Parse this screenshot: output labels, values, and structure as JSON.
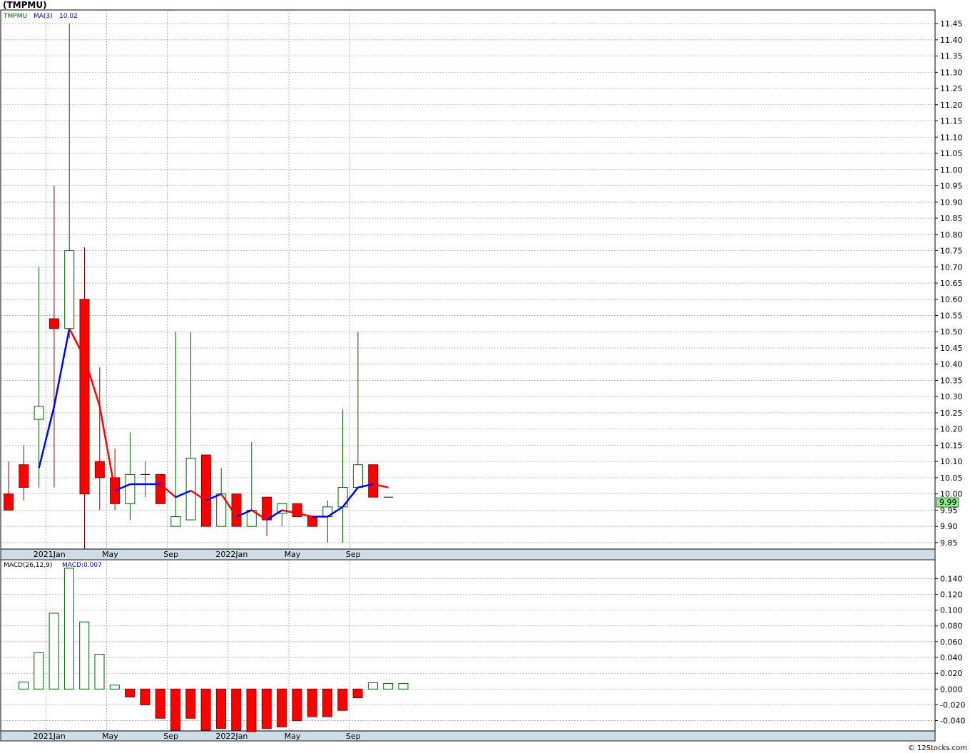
{
  "symbol_title": "(TMPMU)",
  "footer": "© 12Stocks.com",
  "colors": {
    "up": "#006400",
    "down": "#8b0000",
    "down_fill": "#ff0000",
    "ma_up": "#0000ff",
    "ma_down": "#ff0000",
    "axis_band": "#ccdde8",
    "last_price_bg": "#88ee88"
  },
  "chart_data": [
    {
      "type": "candlestick",
      "legend": {
        "symbol": "TMPMU",
        "ma_label": "MA(3)",
        "ma_value": "10.02"
      },
      "last_price_label": "9.99",
      "ylim": [
        9.83,
        11.47
      ],
      "y_ticks": [
        "9.85",
        "9.90",
        "9.95",
        "10.00",
        "10.05",
        "10.10",
        "10.15",
        "10.20",
        "10.25",
        "10.30",
        "10.35",
        "10.40",
        "10.45",
        "10.50",
        "10.55",
        "10.60",
        "10.65",
        "10.70",
        "10.75",
        "10.80",
        "10.85",
        "10.90",
        "10.95",
        "11.00",
        "11.05",
        "11.10",
        "11.15",
        "11.20",
        "11.25",
        "11.30",
        "11.35",
        "11.40",
        "11.45"
      ],
      "x_labels": [
        {
          "label": "2021Jan",
          "index": 3
        },
        {
          "label": "May",
          "index": 7
        },
        {
          "label": "Sep",
          "index": 11
        },
        {
          "label": "2022Jan",
          "index": 15
        },
        {
          "label": "May",
          "index": 19
        },
        {
          "label": "Sep",
          "index": 23
        }
      ],
      "x_gridlines_after_index": [
        3,
        7,
        11,
        15,
        19,
        23
      ],
      "candles": [
        {
          "o": 10.0,
          "h": 10.1,
          "l": 9.95,
          "c": 9.95
        },
        {
          "o": 10.09,
          "h": 10.15,
          "l": 9.98,
          "c": 10.02
        },
        {
          "o": 10.23,
          "h": 10.7,
          "l": 10.02,
          "c": 10.27
        },
        {
          "o": 10.54,
          "h": 10.95,
          "l": 10.02,
          "c": 10.51
        },
        {
          "o": 10.51,
          "h": 11.45,
          "l": 10.48,
          "c": 10.75
        },
        {
          "o": 10.6,
          "h": 10.76,
          "l": 9.83,
          "c": 10.0
        },
        {
          "o": 10.1,
          "h": 10.39,
          "l": 9.95,
          "c": 10.05
        },
        {
          "o": 10.05,
          "h": 10.14,
          "l": 9.95,
          "c": 9.97
        },
        {
          "o": 9.97,
          "h": 10.19,
          "l": 9.92,
          "c": 10.06
        },
        {
          "o": 10.06,
          "h": 10.1,
          "l": 9.99,
          "c": 10.06
        },
        {
          "o": 10.06,
          "h": 10.06,
          "l": 9.97,
          "c": 9.97
        },
        {
          "o": 9.9,
          "h": 10.5,
          "l": 9.9,
          "c": 9.93
        },
        {
          "o": 9.92,
          "h": 10.5,
          "l": 9.92,
          "c": 10.11
        },
        {
          "o": 10.12,
          "h": 10.12,
          "l": 9.9,
          "c": 9.9
        },
        {
          "o": 9.9,
          "h": 10.08,
          "l": 9.9,
          "c": 10.0
        },
        {
          "o": 10.0,
          "h": 10.0,
          "l": 9.9,
          "c": 9.9
        },
        {
          "o": 9.9,
          "h": 10.16,
          "l": 9.9,
          "c": 9.95
        },
        {
          "o": 9.99,
          "h": 9.99,
          "l": 9.87,
          "c": 9.92
        },
        {
          "o": 9.94,
          "h": 9.97,
          "l": 9.9,
          "c": 9.97
        },
        {
          "o": 9.97,
          "h": 9.97,
          "l": 9.93,
          "c": 9.93
        },
        {
          "o": 9.93,
          "h": 9.93,
          "l": 9.9,
          "c": 9.9
        },
        {
          "o": 9.93,
          "h": 9.98,
          "l": 9.85,
          "c": 9.96
        },
        {
          "o": 9.96,
          "h": 10.26,
          "l": 9.85,
          "c": 10.02
        },
        {
          "o": 10.02,
          "h": 10.5,
          "l": 10.02,
          "c": 10.09
        },
        {
          "o": 10.09,
          "h": 10.09,
          "l": 9.99,
          "c": 9.99
        },
        {
          "o": 9.99,
          "h": 9.99,
          "l": 9.99,
          "c": 9.99
        }
      ],
      "ma": [
        null,
        null,
        10.08,
        10.27,
        10.51,
        10.42,
        10.27,
        10.01,
        10.03,
        10.03,
        10.03,
        9.99,
        10.01,
        9.98,
        10.0,
        9.93,
        9.95,
        9.92,
        9.95,
        9.94,
        9.93,
        9.93,
        9.96,
        10.02,
        10.03,
        10.02
      ]
    },
    {
      "type": "bar",
      "legend": {
        "label": "MACD(26,12,9)",
        "value_label": "MACD:0.007"
      },
      "ylim": [
        -0.053,
        0.152
      ],
      "y_ticks": [
        "-0.040",
        "-0.020",
        "0.000",
        "0.020",
        "0.040",
        "0.060",
        "0.080",
        "0.100",
        "0.120",
        "0.140"
      ],
      "x_labels": [
        {
          "label": "2021Jan",
          "index": 3
        },
        {
          "label": "May",
          "index": 7
        },
        {
          "label": "Sep",
          "index": 11
        },
        {
          "label": "2022Jan",
          "index": 15
        },
        {
          "label": "May",
          "index": 19
        },
        {
          "label": "Sep",
          "index": 23
        }
      ],
      "values": [
        0.009,
        0.046,
        0.096,
        0.153,
        0.085,
        0.044,
        0.005,
        -0.01,
        -0.02,
        -0.037,
        -0.052,
        -0.037,
        -0.052,
        -0.05,
        -0.052,
        -0.054,
        -0.05,
        -0.048,
        -0.04,
        -0.035,
        -0.035,
        -0.027,
        -0.011,
        0.008,
        0.007,
        0.007
      ]
    }
  ]
}
